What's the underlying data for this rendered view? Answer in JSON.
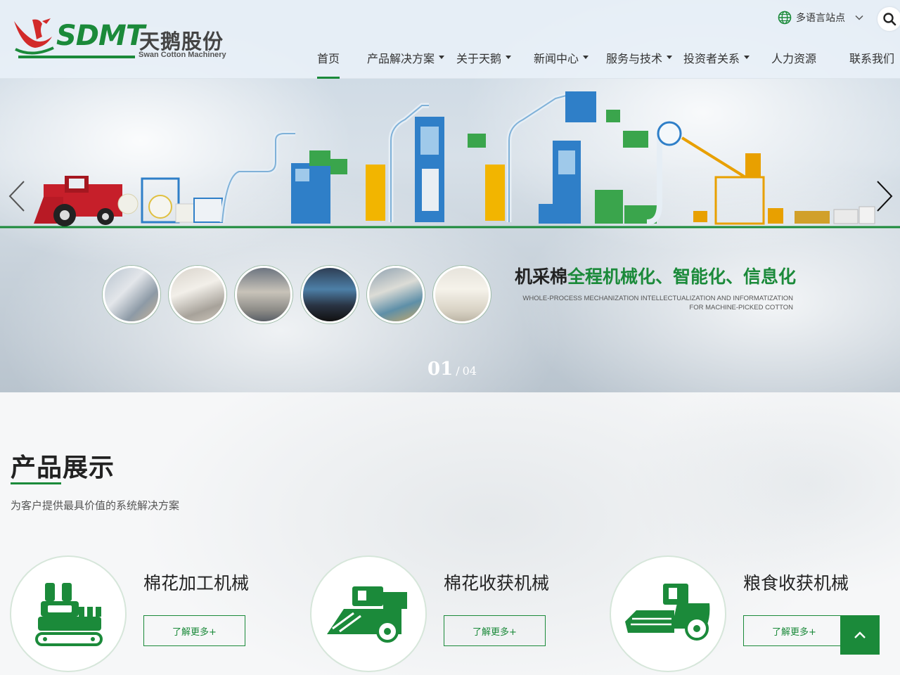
{
  "brand": {
    "logo_text": "SDMT",
    "name_cn": "天鹅股份",
    "name_en": "Swan Cotton Machinery"
  },
  "header": {
    "language_label": "多语言站点",
    "icons": [
      "globe-icon",
      "chevron-down-icon",
      "search-icon"
    ]
  },
  "nav": {
    "items": [
      {
        "label": "首页",
        "active": true,
        "dropdown": false
      },
      {
        "label": "产品解决方案",
        "active": false,
        "dropdown": true
      },
      {
        "label": "关于天鹅",
        "active": false,
        "dropdown": true
      },
      {
        "label": "新闻中心",
        "active": false,
        "dropdown": true
      },
      {
        "label": "服务与技术",
        "active": false,
        "dropdown": true
      },
      {
        "label": "投资者关系",
        "active": false,
        "dropdown": true
      },
      {
        "label": "人力资源",
        "active": false,
        "dropdown": false
      },
      {
        "label": "联系我们",
        "active": false,
        "dropdown": false
      }
    ]
  },
  "banner": {
    "slogan_dark": "机采棉",
    "slogan_green": "全程机械化、智能化、信息化",
    "slogan_en_line1": "WHOLE-PROCESS MECHANIZATION  INTELLECTUALIZATION AND INFORMATIZATION",
    "slogan_en_line2": "FOR MACHINE-PICKED COTTON",
    "current_slide": "01",
    "separator": "/",
    "total_slides": "04"
  },
  "products": {
    "title": "产品展示",
    "subtitle": "为客户提供最具价值的系统解决方案",
    "cards": [
      {
        "title": "棉花加工机械",
        "button": "了解更多+",
        "icon": "cotton-processing-machine-icon"
      },
      {
        "title": "棉花收获机械",
        "button": "了解更多+",
        "icon": "cotton-harvester-icon"
      },
      {
        "title": "粮食收获机械",
        "button": "了解更多+",
        "icon": "grain-harvester-icon"
      }
    ]
  },
  "colors": {
    "brand_green": "#1b8a3a",
    "accent_blue": "#2f7fc8",
    "accent_red": "#d22a2a",
    "accent_yellow": "#f2b500"
  }
}
